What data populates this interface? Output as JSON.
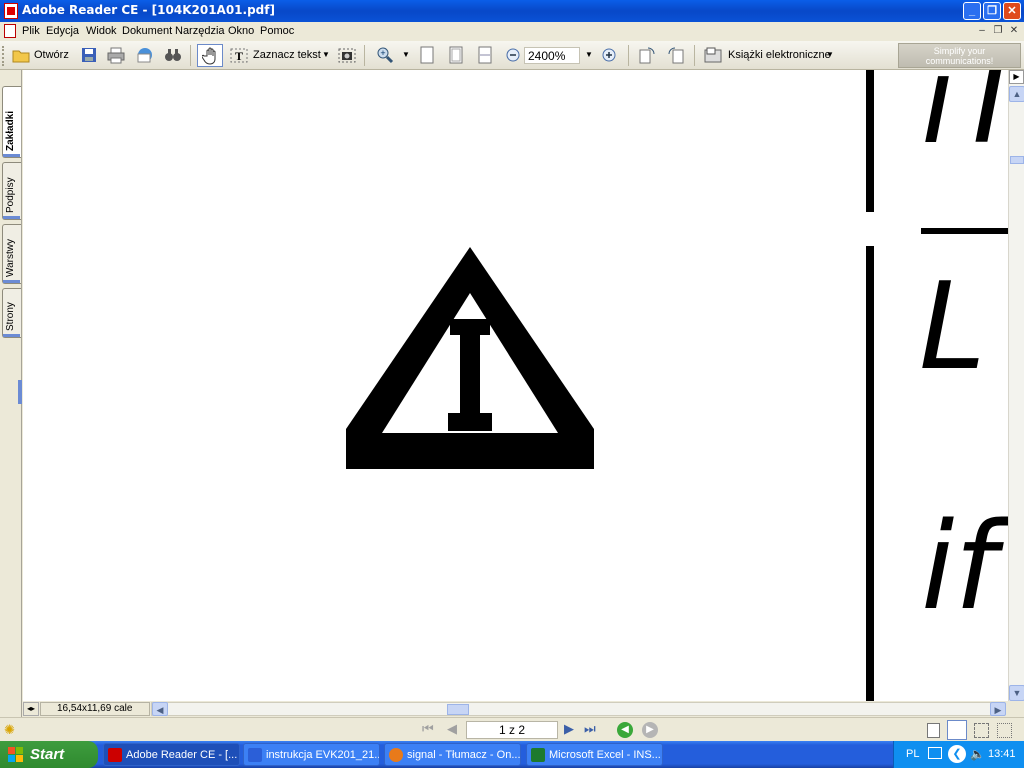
{
  "window": {
    "title": "Adobe Reader CE - [104K201A01.pdf]",
    "controls": {
      "minimize": "_",
      "restore": "❐",
      "close": "✕"
    }
  },
  "menu": {
    "items": [
      "Plik",
      "Edycja",
      "Widok",
      "Dokument",
      "Narzędzia",
      "Okno",
      "Pomoc"
    ],
    "doc_controls": {
      "minimize": "–",
      "restore": "❐",
      "close": "✕"
    }
  },
  "toolbar": {
    "open_label": "Otwórz",
    "select_text_label": "Zaznacz tekst",
    "zoom_value": "2400%",
    "ebooks_label": "Książki elektroniczne",
    "ad_text": "Simplify your communications!"
  },
  "side_tabs": [
    "Zakładki",
    "Podpisy",
    "Warstwy",
    "Strony"
  ],
  "document": {
    "page_size": "16,54x11,69 cale",
    "visible_text": [
      "iT",
      "L",
      "if"
    ]
  },
  "navigation": {
    "page_display": "1 z 2"
  },
  "taskbar": {
    "start_label": "Start",
    "tasks": [
      {
        "label": "Adobe Reader CE - [..."
      },
      {
        "label": "instrukcja EVK201_21..."
      },
      {
        "label": "signal - Tłumacz - On..."
      },
      {
        "label": "Microsoft Excel - INS..."
      }
    ],
    "tray": {
      "language": "PL",
      "time": "13:41"
    }
  }
}
